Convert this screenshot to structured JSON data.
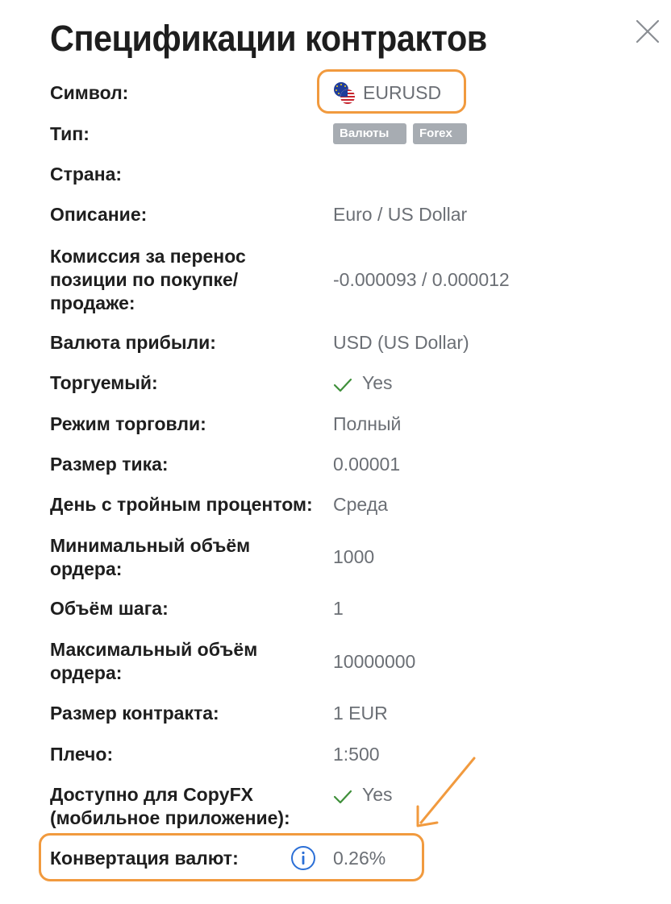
{
  "dialog": {
    "title": "Спецификации контрактов",
    "close_icon": "close-icon"
  },
  "symbol": {
    "label": "Символ:",
    "value": "EURUSD",
    "flag_icon": "eur-usd-flag-icon"
  },
  "type": {
    "label": "Тип:",
    "badges": [
      "Валюты",
      "Forex"
    ]
  },
  "country": {
    "label": "Страна:",
    "value": ""
  },
  "description": {
    "label": "Описание:",
    "value": "Euro / US Dollar"
  },
  "swap": {
    "label_lines": [
      "Комиссия за перенос",
      "позиции по покупке/",
      "продаже:"
    ],
    "value": "-0.000093 / 0.000012"
  },
  "profit_currency": {
    "label": "Валюта прибыли:",
    "value": "USD (US Dollar)"
  },
  "tradable": {
    "label": "Торгуемый:",
    "value": "Yes",
    "icon": "check-icon"
  },
  "trade_mode": {
    "label": "Режим торговли:",
    "value": "Полный"
  },
  "tick_size": {
    "label": "Размер тика:",
    "value": "0.00001"
  },
  "triple_swap_day": {
    "label": "День с тройным процентом:",
    "value": "Среда"
  },
  "min_volume": {
    "label_lines": [
      "Минимальный объём",
      "ордера:"
    ],
    "value": "1000"
  },
  "volume_step": {
    "label": "Объём шага:",
    "value": "1"
  },
  "max_volume": {
    "label_lines": [
      "Максимальный объём",
      "ордера:"
    ],
    "value": "10000000"
  },
  "contract_size": {
    "label": "Размер контракта:",
    "value": "1 EUR"
  },
  "leverage": {
    "label": "Плечо:",
    "value": "1:500"
  },
  "copyfx": {
    "label_lines": [
      "Доступно для CopyFX",
      "(мобильное приложение):"
    ],
    "value": "Yes",
    "icon": "check-icon"
  },
  "currency_conversion": {
    "label": "Конвертация валют:",
    "value": "0.26%",
    "info_icon": "info-icon"
  },
  "colors": {
    "highlight": "#f19a3e",
    "check": "#3f8f3a",
    "badge_bg": "#a7acb2",
    "info_blue": "#2b6fd6"
  }
}
